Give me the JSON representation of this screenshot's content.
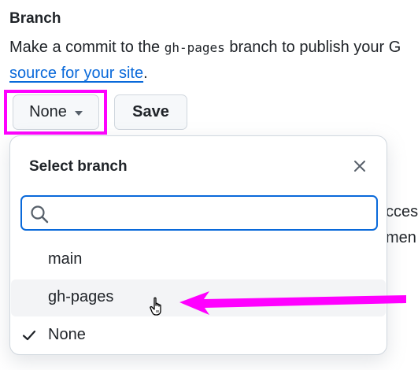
{
  "section": {
    "heading": "Branch",
    "desc_before": "Make a commit to the ",
    "desc_code": "gh-pages",
    "desc_after": " branch to publish your G",
    "link_text": "source for your site",
    "link_after": "."
  },
  "branch_button": {
    "label": "None",
    "icon": "triangle-down-icon"
  },
  "save_button": {
    "label": "Save"
  },
  "background_fragments": [
    "ccess",
    "men"
  ],
  "dropdown": {
    "title": "Select branch",
    "close_icon": "close-icon",
    "search": {
      "placeholder": "",
      "value": "",
      "icon": "search-icon"
    },
    "items": [
      {
        "label": "main",
        "selected": false
      },
      {
        "label": "gh-pages",
        "selected": false
      },
      {
        "label": "None",
        "selected": true
      }
    ]
  },
  "annotation": {
    "highlight_color": "#ff00ff",
    "arrow_color": "#ff00ff"
  },
  "colors": {
    "link": "#0969da",
    "focus_border": "#0969da"
  }
}
